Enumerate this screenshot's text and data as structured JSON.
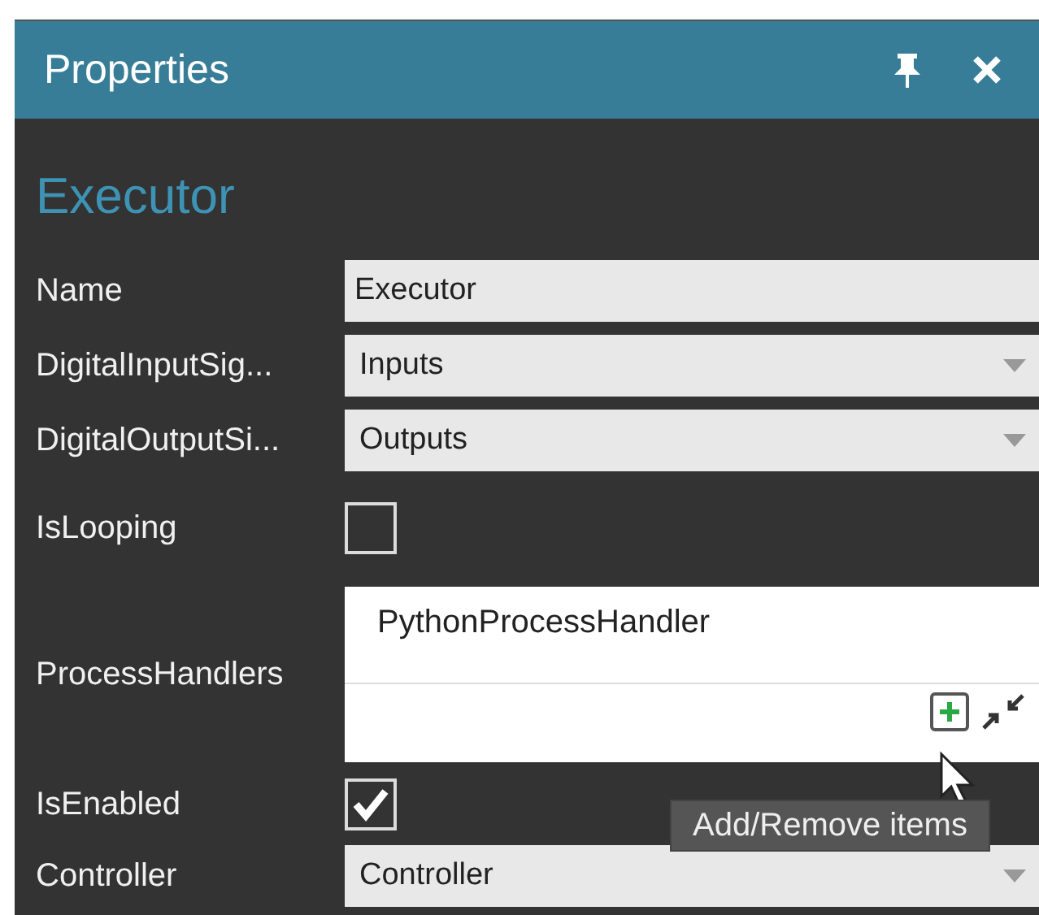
{
  "panel": {
    "title": "Properties"
  },
  "object_name": "Executor",
  "properties": [
    {
      "kind": "text",
      "label": "Name",
      "value": "Executor"
    },
    {
      "kind": "dropdown",
      "label": "DigitalInputSig...",
      "value": "Inputs"
    },
    {
      "kind": "dropdown",
      "label": "DigitalOutputSi...",
      "value": "Outputs"
    },
    {
      "kind": "checkbox",
      "label": "IsLooping",
      "checked": false
    },
    {
      "kind": "list",
      "label": "ProcessHandlers",
      "items": [
        "PythonProcessHandler"
      ]
    },
    {
      "kind": "checkbox",
      "label": "IsEnabled",
      "checked": true
    },
    {
      "kind": "dropdown",
      "label": "Controller",
      "value": "Controller"
    }
  ],
  "tooltip": "Add/Remove items"
}
